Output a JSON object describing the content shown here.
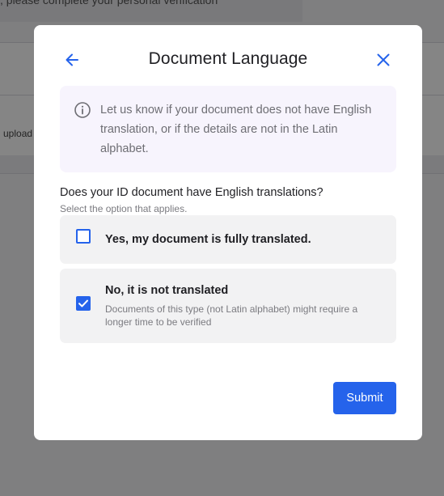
{
  "background": {
    "banner_text": ", please complete your personal verification",
    "upload_text": "upload"
  },
  "modal": {
    "title": "Document Language",
    "back_icon": "arrow-left-icon",
    "close_icon": "close-icon",
    "info": {
      "icon": "info-icon",
      "text": "Let us know if your document does not have English translation, or if the details are not in the Latin alphabet."
    },
    "question": "Does your ID document have English translations?",
    "question_hint": "Select the option that applies.",
    "options": [
      {
        "title": "Yes, my document is fully translated.",
        "description": "",
        "checked": false
      },
      {
        "title": "No, it is not translated",
        "description": "Documents of this type (not Latin alphabet) might require a longer time to be verified",
        "checked": true
      }
    ],
    "submit_label": "Submit"
  },
  "colors": {
    "accent": "#2563eb",
    "info_background": "#f7f4fd",
    "option_background": "#f2f2f3"
  }
}
